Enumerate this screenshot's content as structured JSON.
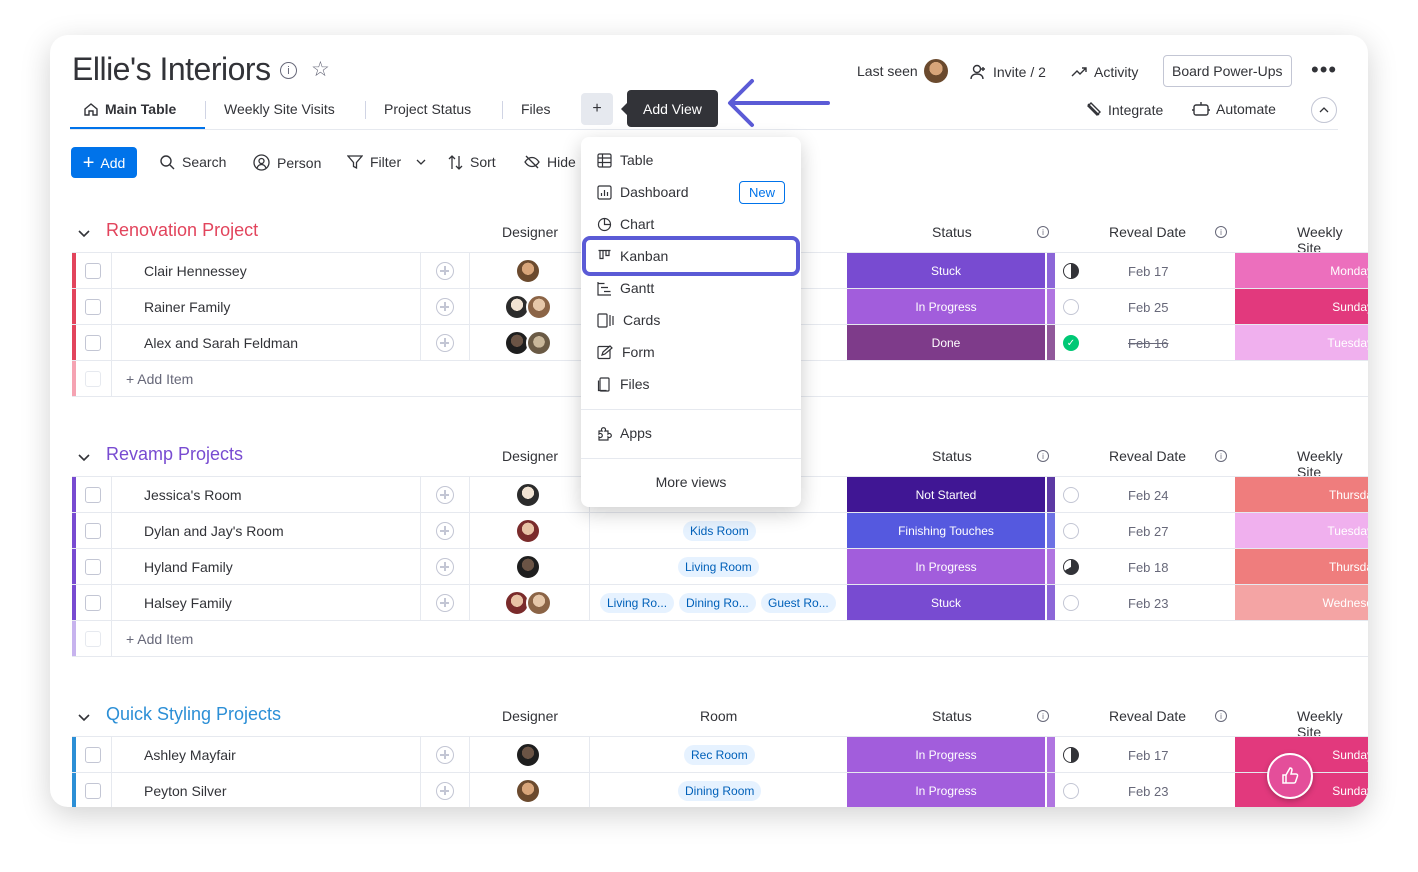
{
  "board": {
    "title": "Ellie's Interiors",
    "last_seen_label": "Last seen",
    "invite_label": "Invite / 2",
    "activity_label": "Activity",
    "power_ups_label": "Board Power-Ups",
    "integrate_label": "Integrate",
    "automate_label": "Automate"
  },
  "tabs": [
    {
      "label": "Main Table"
    },
    {
      "label": "Weekly Site Visits"
    },
    {
      "label": "Project Status"
    },
    {
      "label": "Files"
    }
  ],
  "add_view_tab": {
    "plus": "+",
    "tooltip": "Add View"
  },
  "toolbar": {
    "add_label": "Add",
    "search_label": "Search",
    "person_label": "Person",
    "filter_label": "Filter",
    "sort_label": "Sort",
    "hide_label": "Hide"
  },
  "view_menu": {
    "items": [
      {
        "label": "Table",
        "icon": "table-icon"
      },
      {
        "label": "Dashboard",
        "icon": "dashboard-icon",
        "badge": "New"
      },
      {
        "label": "Chart",
        "icon": "chart-icon"
      },
      {
        "label": "Kanban",
        "icon": "kanban-icon"
      },
      {
        "label": "Gantt",
        "icon": "gantt-icon"
      },
      {
        "label": "Cards",
        "icon": "cards-icon"
      },
      {
        "label": "Form",
        "icon": "form-icon"
      },
      {
        "label": "Files",
        "icon": "files-icon"
      }
    ],
    "apps_label": "Apps",
    "more_label": "More views"
  },
  "columns": {
    "designer": "Designer",
    "room": "Room",
    "status": "Status",
    "reveal_date": "Reveal Date",
    "weekly_site": "Weekly Site"
  },
  "groups": [
    {
      "title": "Renovation Project",
      "color": "#e2445c",
      "add_item": "+ Add Item",
      "rows": [
        {
          "name": "Clair Hennessey",
          "status": "Stuck",
          "status_color": "#784bd1",
          "date": "Feb 17",
          "progress": 0.5,
          "weekly": "Monday",
          "weekly_color": "#ec6fbd"
        },
        {
          "name": "Rainer Family",
          "status": "In Progress",
          "status_color": "#a25ddc",
          "date": "Feb 25",
          "progress": 0,
          "weekly": "Sunday",
          "weekly_color": "#e2397d"
        },
        {
          "name": "Alex and Sarah Feldman",
          "status": "Done",
          "status_color": "#7e3b8a",
          "date": "Feb 16",
          "progress": 1,
          "weekly": "Tuesday",
          "weekly_color": "#f0b0ee"
        }
      ]
    },
    {
      "title": "Revamp Projects",
      "color": "#784bd1",
      "add_item": "+ Add Item",
      "rows": [
        {
          "name": "Jessica's Room",
          "status": "Not Started",
          "status_color": "#401694",
          "date": "Feb 24",
          "progress": 0,
          "weekly": "Thursda",
          "weekly_color": "#ef7d7d",
          "rooms": []
        },
        {
          "name": "Dylan and Jay's Room",
          "status": "Finishing Touches",
          "status_color": "#5559df",
          "date": "Feb 27",
          "progress": 0,
          "weekly": "Tuesday",
          "weekly_color": "#f0b0ee",
          "rooms": [
            "Kids Room"
          ]
        },
        {
          "name": "Hyland Family",
          "status": "In Progress",
          "status_color": "#a25ddc",
          "date": "Feb 18",
          "progress": 0.66,
          "weekly": "Thursda",
          "weekly_color": "#ef7d7d",
          "rooms": [
            "Living Room"
          ]
        },
        {
          "name": "Halsey Family",
          "status": "Stuck",
          "status_color": "#784bd1",
          "date": "Feb 23",
          "progress": 0,
          "weekly": "Wednesd",
          "weekly_color": "#f4a4a4",
          "rooms": [
            "Living Ro...",
            "Dining Ro...",
            "Guest Ro..."
          ]
        }
      ]
    },
    {
      "title": "Quick Styling Projects",
      "color": "#2c8fd6",
      "rows": [
        {
          "name": "Ashley Mayfair",
          "status": "In Progress",
          "status_color": "#a25ddc",
          "date": "Feb 17",
          "progress": 0.5,
          "weekly": "Sunday",
          "weekly_color": "#e2397d",
          "rooms": [
            "Rec Room"
          ]
        },
        {
          "name": "Peyton Silver",
          "status": "In Progress",
          "status_color": "#a25ddc",
          "date": "Feb 23",
          "progress": 0,
          "weekly": "Sunday",
          "weekly_color": "#e2397d",
          "rooms": [
            "Dining Room"
          ]
        }
      ]
    }
  ],
  "colors": {
    "accent": "#0073ea",
    "highlight": "#5b5bd6",
    "chat_bubble": "#e44e9a"
  }
}
